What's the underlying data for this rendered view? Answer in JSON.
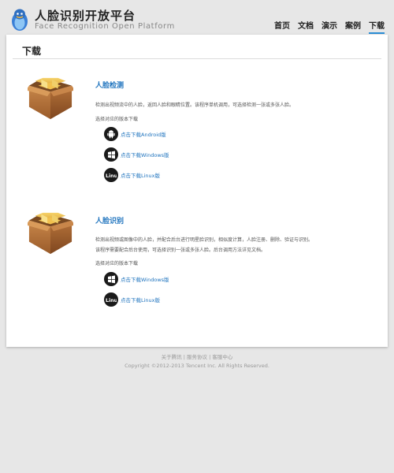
{
  "header": {
    "title": "人脸识别开放平台",
    "subtitle": "Face Recognition Open Platform",
    "nav": [
      "首页",
      "文档",
      "演示",
      "案例",
      "下载"
    ]
  },
  "page": {
    "title": "下载"
  },
  "sections": [
    {
      "title": "人脸检测",
      "desc_lines": [
        "检测出视频流中的人脸，返回人脸和眼睛位置。该程序单机调用，可选择检测一张或多张人脸。"
      ],
      "select_label": "选择对应的版本下载",
      "downloads": [
        "点击下载Android版",
        "点击下载Windows版",
        "点击下载Linux版"
      ]
    },
    {
      "title": "人脸识别",
      "desc_lines": [
        "检测出视频或图像中的人脸，并配合后台进行明星脸识别，相似度计算，人脸注册、删除、验证与识别。",
        "该程序需要配合后台使用，可选择识别一张或多张人脸。后台调用方法详见文档。"
      ],
      "select_label": "选择对应的版本下载",
      "downloads": [
        "点击下载Windows版",
        "点击下载Linux版"
      ]
    }
  ],
  "footer": {
    "link_about": "关于腾讯",
    "link_terms": "服务协议",
    "link_help": "客服中心",
    "separator": " | ",
    "copyright": "Copyright ©2012-2013 Tencent Inc. All Rights Reserved."
  },
  "icons": {
    "logo": "qq-penguin-icon",
    "section": "package-box-icon",
    "android": "android-icon",
    "windows": "windows-icon",
    "linux": "linux-icon"
  },
  "colors": {
    "accent": "#1e73be",
    "nav_active": "#2b8fd6",
    "background": "#e7e7e7",
    "panel": "#ffffff"
  }
}
